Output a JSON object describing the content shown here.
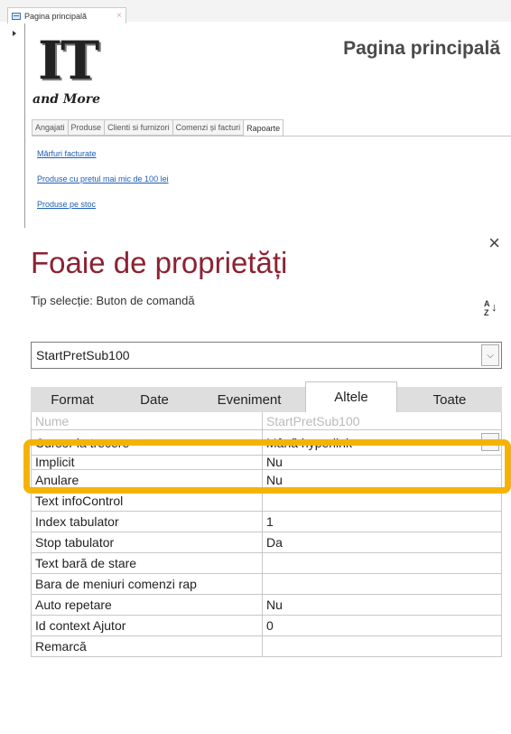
{
  "form_window": {
    "doc_tab_label": "Pagina principală",
    "doc_tab_close": "×",
    "logo_it": "IT",
    "logo_and_more": "and More",
    "title": "Pagina principală",
    "tabs": [
      "Angajati",
      "Produse",
      "Clienti si furnizori",
      "Comenzi și facturi",
      "Rapoarte"
    ],
    "active_tab": "Rapoarte",
    "links": [
      "Mărfuri facturate",
      "Produse cu pretul mai mic de 100 lei",
      "Produse pe stoc"
    ]
  },
  "property_sheet": {
    "close": "×",
    "title": "Foaie de proprietăți",
    "selection_type": "Tip selecție:  Buton de comandă",
    "sort_icon": "sort-az-icon",
    "object_name": "StartPretSub100",
    "tabs": [
      "Format",
      "Date",
      "Eveniment",
      "Altele",
      "Toate"
    ],
    "active_tab": "Altele",
    "rows": [
      {
        "name": "Nume",
        "value": "StartPretSub100"
      },
      {
        "name": "Cursor la trecere",
        "value": "Mână hyperlink"
      },
      {
        "name": "Implicit",
        "value": "Nu"
      },
      {
        "name": "Anulare",
        "value": "Nu"
      },
      {
        "name": "Text infoControl",
        "value": ""
      },
      {
        "name": "Index tabulator",
        "value": "1"
      },
      {
        "name": "Stop tabulator",
        "value": "Da"
      },
      {
        "name": "Text bară de stare",
        "value": ""
      },
      {
        "name": "Bara de meniuri comenzi rap",
        "value": ""
      },
      {
        "name": "Auto repetare",
        "value": "Nu"
      },
      {
        "name": "Id context Ajutor",
        "value": "0"
      },
      {
        "name": "Remarcă",
        "value": ""
      }
    ],
    "highlight_color": "#f5b301",
    "title_color": "#8c2232"
  }
}
